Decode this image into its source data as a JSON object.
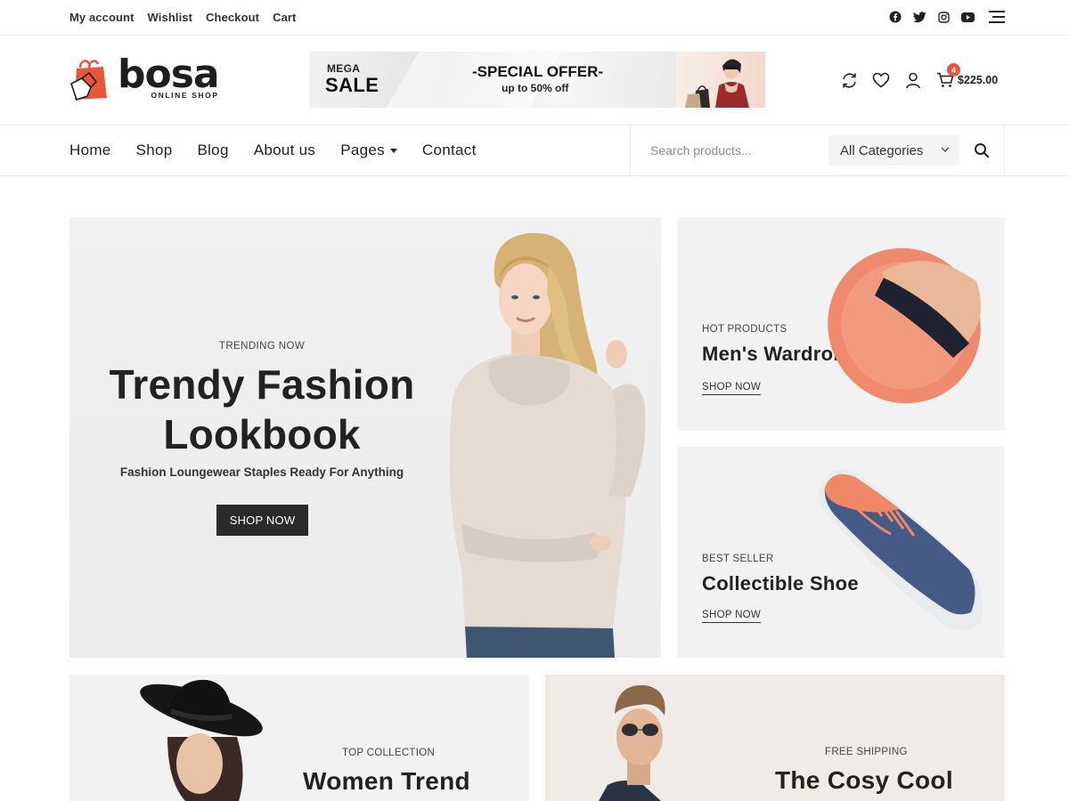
{
  "topbar": {
    "links": [
      "My account",
      "Wishlist",
      "Checkout",
      "Cart"
    ],
    "social_icons": [
      "facebook-icon",
      "twitter-icon",
      "instagram-icon",
      "youtube-icon",
      "hamburger-menu-icon"
    ]
  },
  "header": {
    "logo_name": "bosa",
    "logo_tagline": "ONLINE SHOP",
    "promo": {
      "mega": "MEGA",
      "sale": "SALE",
      "offer": "-SPECIAL OFFER-",
      "upto": "up to 50% off"
    },
    "icons": [
      "compare-icon",
      "wishlist-heart-icon",
      "user-icon",
      "cart-icon"
    ],
    "cart_count": "4",
    "cart_total": "$225.00",
    "accent_color": "#e8573a"
  },
  "nav": {
    "links": [
      "Home",
      "Shop",
      "Blog",
      "About us",
      "Pages",
      "Contact"
    ],
    "search_placeholder": "Search products...",
    "category_select": "All Categories"
  },
  "hero": {
    "kicker": "TRENDING NOW",
    "title_line1": "Trendy Fashion",
    "title_line2": "Lookbook",
    "subtitle": "Fashion Loungewear Staples Ready For Anything",
    "button": "SHOP NOW"
  },
  "cards": {
    "hat": {
      "kicker": "HOT PRODUCTS",
      "title": "Men's Wardrobe",
      "link": "SHOP NOW"
    },
    "shoe": {
      "kicker": "BEST SELLER",
      "title": "Collectible Shoe",
      "link": "SHOP NOW"
    },
    "women": {
      "kicker": "TOP COLLECTION",
      "title": "Women Trend"
    },
    "cosy": {
      "kicker": "FREE SHIPPING",
      "title": "The Cosy Cool"
    }
  }
}
